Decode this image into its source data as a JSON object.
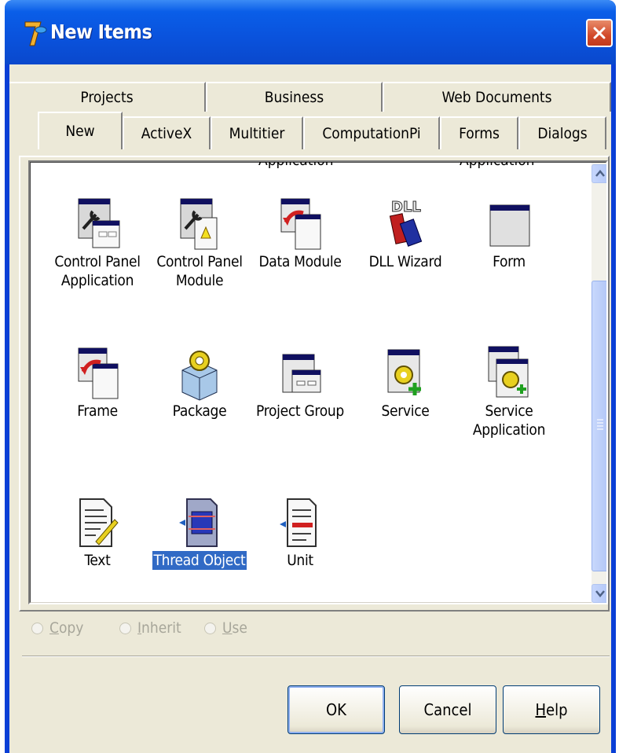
{
  "window": {
    "title": "New Items",
    "close_icon": "close-icon"
  },
  "tabs_row1": [
    "Projects",
    "Business",
    "Web Documents"
  ],
  "tabs_row2": [
    "New",
    "ActiveX",
    "Multitier",
    "ComputationPi",
    "Forms",
    "Dialogs"
  ],
  "active_tab": "New",
  "partial_row_labels": [
    "Application",
    "Application"
  ],
  "items": [
    {
      "label": "Control Panel Application",
      "icon": "control-panel-application-icon"
    },
    {
      "label": "Control Panel Module",
      "icon": "control-panel-module-icon"
    },
    {
      "label": "Data Module",
      "icon": "data-module-icon"
    },
    {
      "label": "DLL Wizard",
      "icon": "dll-wizard-icon"
    },
    {
      "label": "Form",
      "icon": "form-icon"
    },
    {
      "label": "Frame",
      "icon": "frame-icon"
    },
    {
      "label": "Package",
      "icon": "package-icon"
    },
    {
      "label": "Project Group",
      "icon": "project-group-icon"
    },
    {
      "label": "Service",
      "icon": "service-icon"
    },
    {
      "label": "Service Application",
      "icon": "service-application-icon"
    },
    {
      "label": "Text",
      "icon": "text-icon"
    },
    {
      "label": "Thread Object",
      "icon": "thread-object-icon"
    },
    {
      "label": "Unit",
      "icon": "unit-icon"
    }
  ],
  "selected_item": "Thread Object",
  "options": [
    {
      "key": "C",
      "rest": "opy"
    },
    {
      "key": "I",
      "rest": "nherit"
    },
    {
      "key": "U",
      "rest": "se"
    }
  ],
  "buttons": {
    "ok": "OK",
    "cancel": "Cancel",
    "help_key": "H",
    "help_rest": "elp"
  },
  "colors": {
    "titlebar": "#0a52dc",
    "selection": "#316ac5",
    "face": "#ece9d8"
  }
}
